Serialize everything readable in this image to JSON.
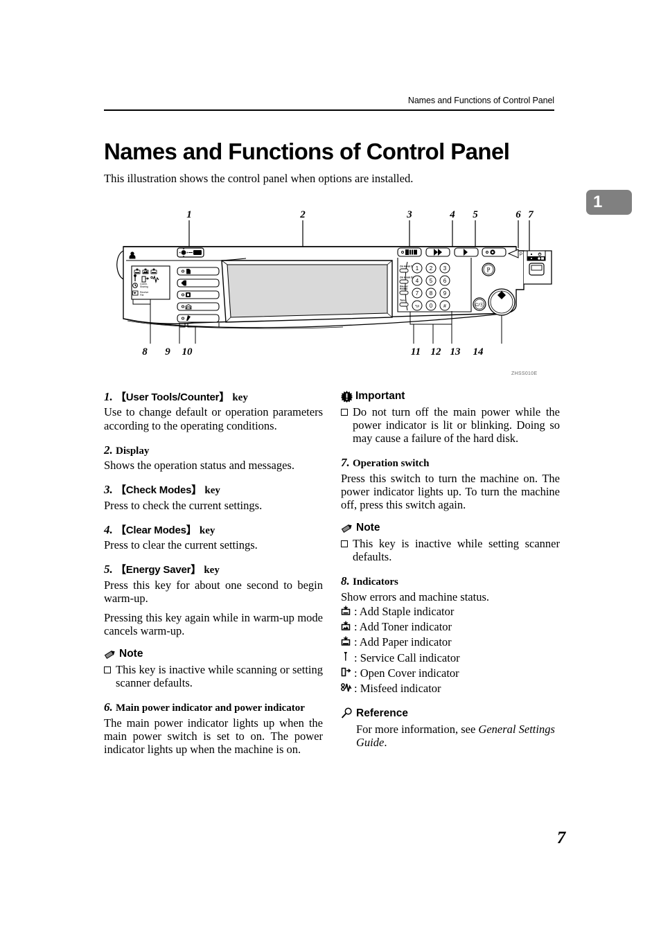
{
  "header": {
    "running_title": "Names and Functions of Control Panel"
  },
  "chapter_tab": {
    "number": "1"
  },
  "title": "Names and Functions of Control Panel",
  "intro": "This illustration shows the control panel when options are installed.",
  "figure": {
    "id_label": "ZHSS010E",
    "callouts_top": [
      "1",
      "2",
      "3",
      "4",
      "5",
      "6",
      "7"
    ],
    "callouts_bottom": [
      "8",
      "9",
      "10",
      "11",
      "12",
      "13",
      "14"
    ],
    "keypad_keys": [
      "1",
      "2",
      "3",
      "4",
      "5",
      "6",
      "7",
      "8",
      "9",
      "*/#",
      "0",
      "#"
    ],
    "side_key_labels": [
      "On Hook Dial",
      "On Hook Dial",
      "Pause/ Redial",
      "Tone"
    ],
    "clear_stop_label": "C/⊘",
    "program_label": "P"
  },
  "left_column": {
    "item1": {
      "index": "1.",
      "key": "【User Tools/Counter】",
      "suffix": "key",
      "body": "Use to change default or operation parameters according to the operating conditions."
    },
    "item2": {
      "index": "2.",
      "heading": "Display",
      "body": "Shows the operation status and messages."
    },
    "item3": {
      "index": "3.",
      "key": "【Check Modes】",
      "suffix": "key",
      "body": "Press to check the current settings."
    },
    "item4": {
      "index": "4.",
      "key": "【Clear Modes】",
      "suffix": "key",
      "body": "Press to clear the current settings."
    },
    "item5": {
      "index": "5.",
      "key": "【Energy Saver】",
      "suffix": "key",
      "body1": "Press this key for about one second to begin warm-up.",
      "body2": "Pressing this key again while in warm-up mode cancels warm-up."
    },
    "note": {
      "label": "Note",
      "bullet": "This key is inactive while scanning or setting scanner defaults."
    },
    "item6": {
      "index": "6.",
      "heading": "Main power indicator and power indicator",
      "body": "The main power indicator lights up when the main power switch is set to on. The power indicator lights up when the machine is on."
    }
  },
  "right_column": {
    "important": {
      "label": "Important",
      "bullet": "Do not turn off the main power while the power indicator is lit or blinking. Doing so may cause a failure of the hard disk."
    },
    "item7": {
      "index": "7.",
      "heading": "Operation switch",
      "body": "Press this switch to turn the machine on. The power indicator lights up. To turn the machine off, press this switch again."
    },
    "note": {
      "label": "Note",
      "bullet": "This key is inactive while setting scanner defaults."
    },
    "item8": {
      "index": "8.",
      "heading": "Indicators",
      "body": "Show errors and machine status.",
      "indicators": [
        {
          "icon": "add-staple-icon",
          "label": ": Add Staple indicator"
        },
        {
          "icon": "add-toner-icon",
          "label": ": Add Toner indicator"
        },
        {
          "icon": "add-paper-icon",
          "label": ": Add Paper indicator"
        },
        {
          "icon": "service-call-icon",
          "label": ": Service Call indicator"
        },
        {
          "icon": "open-cover-icon",
          "label": ": Open Cover indicator"
        },
        {
          "icon": "misfeed-icon",
          "label": ": Misfeed indicator"
        }
      ]
    },
    "reference": {
      "label": "Reference",
      "body_plain": "For more information, see ",
      "body_italic": "General Settings Guide",
      "body_tail": "."
    }
  },
  "page_number": "7"
}
